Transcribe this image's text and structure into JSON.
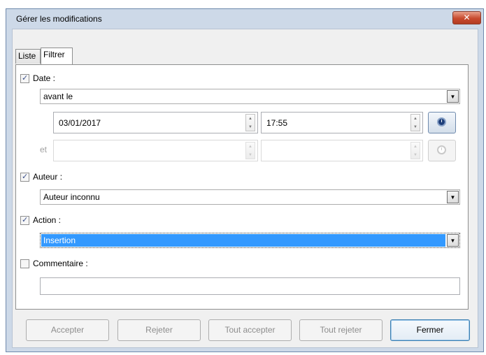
{
  "window": {
    "title": "Gérer les modifications",
    "close_glyph": "✕"
  },
  "tabs": [
    {
      "label": "Liste",
      "active": false
    },
    {
      "label": "Filtrer",
      "active": true
    }
  ],
  "filter": {
    "date": {
      "label": "Date :",
      "checked": true,
      "condition": "avant le",
      "first_date": "03/01/2017",
      "first_time": "17:55",
      "and_label": "et",
      "second_date": "",
      "second_time": ""
    },
    "author": {
      "label": "Auteur :",
      "checked": true,
      "value": "Auteur inconnu"
    },
    "action": {
      "label": "Action :",
      "checked": true,
      "value": "Insertion"
    },
    "comment": {
      "label": "Commentaire :",
      "checked": false,
      "value": ""
    }
  },
  "buttons": {
    "accept": "Accepter",
    "reject": "Rejeter",
    "accept_all": "Tout accepter",
    "reject_all": "Tout rejeter",
    "close": "Fermer"
  },
  "glyphs": {
    "check": "✓",
    "dropdown": "▼",
    "spin_up": "▲",
    "spin_down": "▼"
  },
  "colors": {
    "selection": "#3399ff",
    "window_frame": "#cdd9e8"
  }
}
